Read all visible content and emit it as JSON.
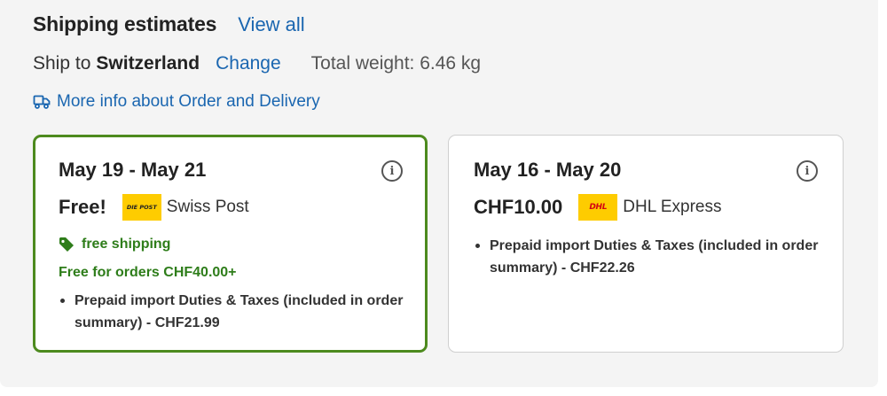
{
  "header": {
    "title": "Shipping estimates",
    "view_all": "View all"
  },
  "ship_to": {
    "prefix": "Ship to",
    "country": "Switzerland",
    "change_label": "Change",
    "total_weight": "Total weight: 6.46 kg"
  },
  "more_info": {
    "label": "More info about Order and Delivery",
    "icon": "delivery-truck-icon"
  },
  "options": [
    {
      "selected": true,
      "date_range": "May 19 - May 21",
      "price": "Free!",
      "carrier": "Swiss Post",
      "logo_text": "DIE POST",
      "free_shipping_label": "free shipping",
      "free_threshold": "Free for orders CHF40.00+",
      "note": "Prepaid import Duties & Taxes (included in order summary) - CHF21.99"
    },
    {
      "selected": false,
      "date_range": "May 16 - May 20",
      "price": "CHF10.00",
      "carrier": "DHL Express",
      "logo_text": "DHL",
      "note": "Prepaid import Duties & Taxes (included in order summary) - CHF22.26"
    }
  ],
  "colors": {
    "link": "#1a66b0",
    "selected_border": "#4d8a1e",
    "green_text": "#2e7d1a",
    "logo_yellow": "#fecc00",
    "dhl_red": "#d40511"
  }
}
